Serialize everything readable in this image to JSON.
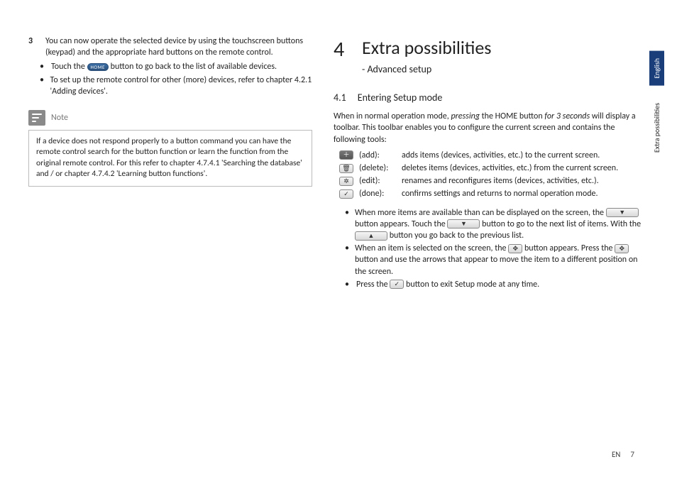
{
  "left": {
    "step3_num": "3",
    "step3_text": "You can now operate the selected device by using the touchscreen buttons (keypad) and the appropriate hard buttons on the remote control.",
    "bullet1_a": "Touch the ",
    "bullet1_home": "HOME",
    "bullet1_b": " button to go back to the list of available devices.",
    "bullet2": "To set up the remote control for other (more) devices, refer to chapter 4.2.1 'Adding devices'.",
    "note_label": "Note",
    "note_body": "If a device does not respond properly to a button command you can have the remote control search for the button function or learn the function from the original remote control. For this refer to chapter 4.7.4.1 'Searching the database' and / or chapter 4.7.4.2 'Learning button functions'."
  },
  "right": {
    "chapter_num": "4",
    "chapter_title": "Extra possibilities",
    "chapter_sub": "- Advanced setup",
    "sec_num": "4.1",
    "sec_title": "Entering Setup mode",
    "intro_a": "When in normal operation mode, ",
    "intro_press": "pressing",
    "intro_b": " the HOME button ",
    "intro_for3": "for 3 seconds",
    "intro_c": " will display a toolbar. This toolbar enables you to configure the current screen and contains the following tools:",
    "tools": {
      "add": {
        "icon": "＋",
        "label": "(add):",
        "desc": "adds items (devices, activities, etc.) to the current screen."
      },
      "delete": {
        "icon": "🗑",
        "label": "(delete):",
        "desc": "deletes items (devices, activities, etc.) from the current screen."
      },
      "edit": {
        "icon": "✲",
        "label": "(edit):",
        "desc": "renames and reconfigures items (devices, activities, etc.)."
      },
      "done": {
        "icon": "✓",
        "label": "(done):",
        "desc": "confirms settings and returns to normal operation mode."
      }
    },
    "b1_a": "When more items are available than can be displayed on the screen, the ",
    "b1_down": "▼",
    "b1_b": " button appears. Touch the ",
    "b1_c": " button to go to the next list of items. With the ",
    "b1_up": "▲",
    "b1_d": " button you go back to the previous list.",
    "b2_a": "When an item is selected on the screen, the ",
    "b2_move": "✥",
    "b2_b": " button appears. Press the ",
    "b2_c": " button and use the arrows that appear to move the item to a different position on the screen.",
    "b3_a": "Press the ",
    "b3_done": "✓",
    "b3_b": " button to exit Setup mode at any time."
  },
  "tabs": {
    "lang": "English",
    "section": "Extra possibilities"
  },
  "footer": {
    "lang": "EN",
    "page": "7"
  }
}
